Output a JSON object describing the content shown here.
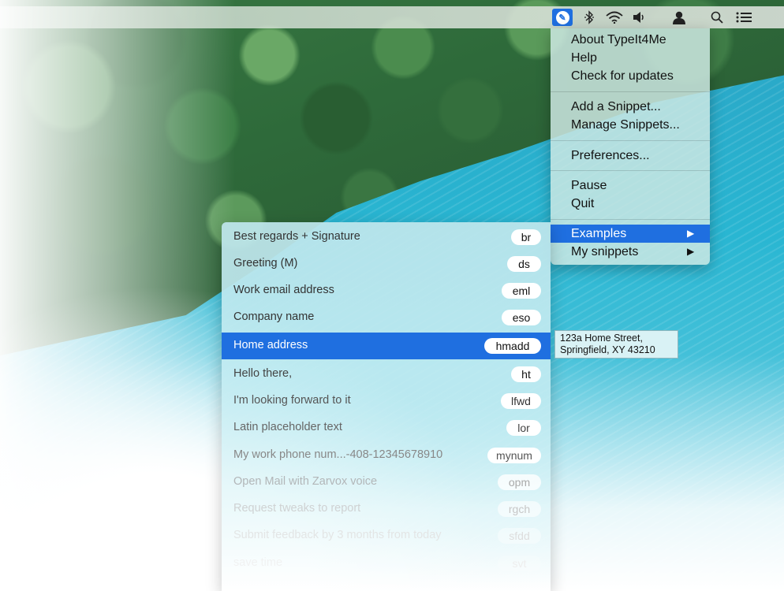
{
  "menubar": {
    "icons": [
      "typeit4me-icon",
      "bluetooth-icon",
      "wifi-icon",
      "volume-icon",
      "user-icon",
      "spotlight-search-icon",
      "notification-center-icon"
    ]
  },
  "main_menu": {
    "items": [
      {
        "label": "About TypeIt4Me"
      },
      {
        "label": "Help"
      },
      {
        "label": "Check for updates"
      },
      {
        "label": "Add a Snippet..."
      },
      {
        "label": "Manage Snippets..."
      },
      {
        "label": "Preferences..."
      },
      {
        "label": "Pause"
      },
      {
        "label": "Quit"
      },
      {
        "label": "Examples",
        "arrow": "▶",
        "highlighted": true
      },
      {
        "label": "My snippets",
        "arrow": "▶"
      }
    ]
  },
  "submenu": {
    "items": [
      {
        "label": "Best regards + Signature",
        "abbrev": "br"
      },
      {
        "label": "Greeting (M)",
        "abbrev": "ds"
      },
      {
        "label": "Work email address",
        "abbrev": "eml"
      },
      {
        "label": "Company name",
        "abbrev": "eso"
      },
      {
        "label": "Home address",
        "abbrev": "hmadd",
        "selected": true
      },
      {
        "label": "Hello there,",
        "abbrev": "ht"
      },
      {
        "label": "I'm looking forward to it",
        "abbrev": "lfwd"
      },
      {
        "label": "Latin placeholder text",
        "abbrev": "lor"
      },
      {
        "label": "My work phone num...-408-12345678910",
        "abbrev": "mynum"
      },
      {
        "label": "Open Mail with Zarvox voice",
        "abbrev": "opm"
      },
      {
        "label": "Request tweaks to report",
        "abbrev": "rgch"
      },
      {
        "label": "Submit feedback by 3 months from today",
        "abbrev": "sfdd"
      },
      {
        "label": "save time",
        "abbrev": "svt"
      }
    ]
  },
  "tooltip": {
    "line1": "123a Home Street,",
    "line2": "Springfield, XY 43210"
  },
  "colors": {
    "accent": "#1f6fe0"
  }
}
